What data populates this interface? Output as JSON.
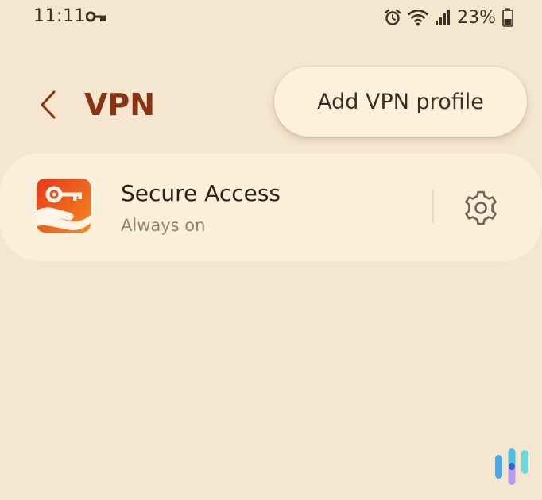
{
  "status_bar": {
    "time": "11:11",
    "battery_percent": "23%",
    "icons": [
      "vpn-key-icon",
      "alarm-icon",
      "wifi-icon",
      "signal-icon",
      "battery-icon"
    ]
  },
  "header": {
    "title": "VPN",
    "back_icon": "chevron-left-icon"
  },
  "menu": {
    "add_vpn_label": "Add VPN profile"
  },
  "vpn_list": [
    {
      "name": "Secure Access",
      "status": "Always on",
      "icon": "secure-access-app-icon",
      "settings_icon": "gear-icon"
    }
  ],
  "colors": {
    "background": "#f5e6cf",
    "card": "#fcefd9",
    "title": "#8a3312",
    "app_icon_red": "#e8401c",
    "app_icon_orange": "#f47a20"
  }
}
